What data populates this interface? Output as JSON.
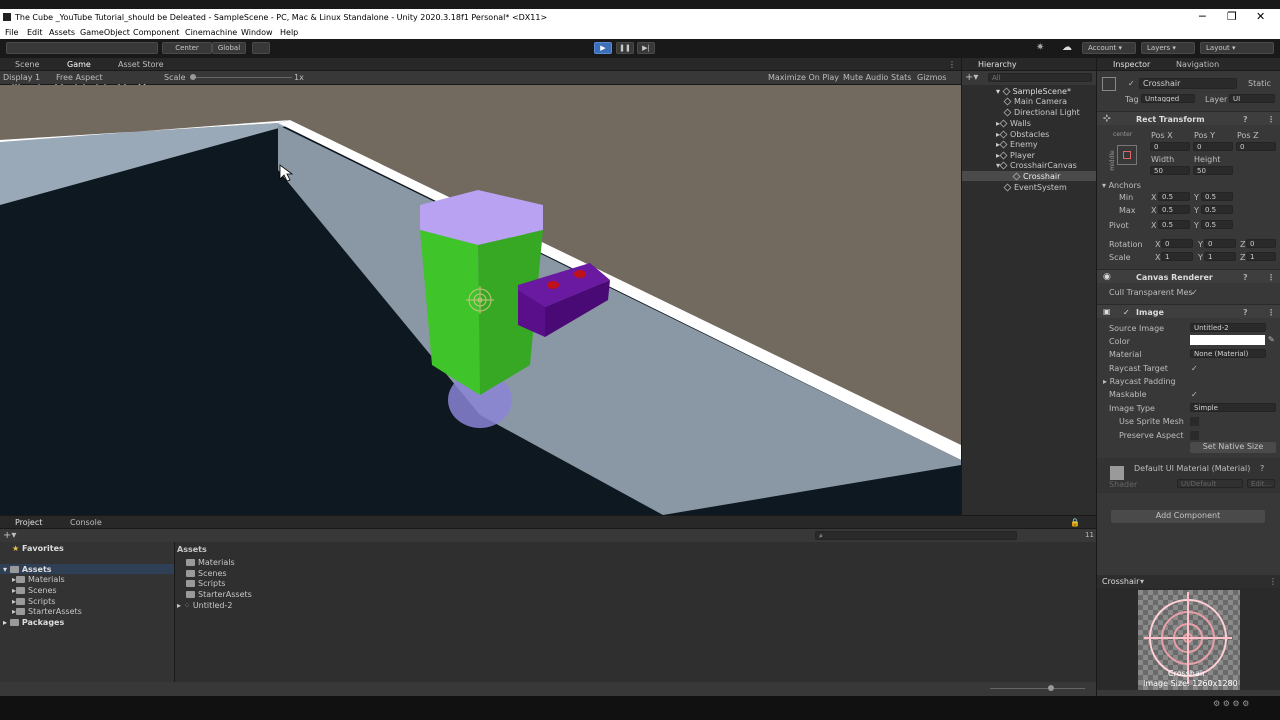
{
  "window": {
    "title": "The Cube _YouTube Tutorial_should be Deleated - SampleScene - PC, Mac & Linux Standalone - Unity 2020.3.18f1 Personal* <DX11>",
    "controls": [
      "─",
      "❐",
      "✕"
    ]
  },
  "menu": [
    "File",
    "Edit",
    "Assets",
    "GameObject",
    "Component",
    "Cinemachine",
    "Window",
    "Help"
  ],
  "toolbar": {
    "pivot": "Center",
    "space": "Global",
    "account": "Account",
    "layers": "Layers",
    "layout": "Layout"
  },
  "view_tabs": {
    "scene": "Scene",
    "game": "Game",
    "asset_store": "Asset Store"
  },
  "game_bar": {
    "display": "Display 1",
    "aspect": "Free Aspect",
    "scale_label": "Scale",
    "scale_value": "1x",
    "maximize": "Maximize On Play",
    "mute": "Mute Audio",
    "stats": "Stats",
    "gizmos": "Gizmos"
  },
  "hierarchy": {
    "tab": "Hierarchy",
    "search_placeholder": "All",
    "scene": "SampleScene*",
    "items": [
      "Main Camera",
      "Directional Light",
      "Walls",
      "Obstacles",
      "Enemy",
      "Player",
      "CrosshairCanvas",
      "Crosshair",
      "EventSystem"
    ]
  },
  "inspector": {
    "tabs": [
      "Inspector",
      "Navigation"
    ],
    "object_name": "Crosshair",
    "static_label": "Static",
    "tag_label": "Tag",
    "tag_value": "Untagged",
    "layer_label": "Layer",
    "layer_value": "UI",
    "rect_transform": {
      "title": "Rect Transform",
      "anchor_preset_h": "center",
      "anchor_preset_v": "middle",
      "posx_label": "Pos X",
      "posy_label": "Pos Y",
      "posz_label": "Pos Z",
      "posx": "0",
      "posy": "0",
      "posz": "0",
      "width_label": "Width",
      "height_label": "Height",
      "width": "50",
      "height": "50",
      "anchors_label": "Anchors",
      "min_label": "Min",
      "max_label": "Max",
      "pivot_label": "Pivot",
      "x_label": "X",
      "y_label": "Y",
      "z_label": "Z",
      "min_x": "0.5",
      "min_y": "0.5",
      "max_x": "0.5",
      "max_y": "0.5",
      "pivot_x": "0.5",
      "pivot_y": "0.5",
      "rotation_label": "Rotation",
      "rot_x": "0",
      "rot_y": "0",
      "rot_z": "0",
      "scale_label": "Scale",
      "scale_x": "1",
      "scale_y": "1",
      "scale_z": "1"
    },
    "canvas_renderer": {
      "title": "Canvas Renderer",
      "cull_label": "Cull Transparent Mes",
      "cull_checked": "✓"
    },
    "image": {
      "title": "Image",
      "source_label": "Source Image",
      "source_value": "Untitled-2",
      "color_label": "Color",
      "color_value": "#ffffff",
      "material_label": "Material",
      "material_value": "None (Material)",
      "raycast_label": "Raycast Target",
      "raycast_padding_label": "Raycast Padding",
      "maskable_label": "Maskable",
      "type_label": "Image Type",
      "type_value": "Simple",
      "sprite_mesh_label": "Use Sprite Mesh",
      "preserve_label": "Preserve Aspect",
      "native_size_button": "Set Native Size",
      "check": "✓"
    },
    "material": {
      "title": "Default UI Material (Material)",
      "shader_label": "Shader",
      "shader_value": "UI/Default",
      "edit_button": "Edit..."
    },
    "add_component": "Add Component",
    "preview": {
      "title": "Crosshair",
      "caption_name": "Crosshair",
      "caption_size": "Image Size: 1260x1280"
    }
  },
  "project": {
    "tabs": [
      "Project",
      "Console"
    ],
    "favorites": "Favorites",
    "assets_root": "Assets",
    "tree": [
      "Materials",
      "Scenes",
      "Scripts",
      "StarterAssets"
    ],
    "packages": "Packages",
    "breadcrumb": "Assets",
    "files": [
      "Materials",
      "Scenes",
      "Scripts",
      "StarterAssets",
      "Untitled-2"
    ],
    "hidden_count": "11"
  },
  "colors": {
    "editor_bg": "#383838",
    "wall_white": "#ffffff",
    "floor_dark": "#0e1820",
    "player_green": "#3fc429",
    "player_top": "#b9a2f2",
    "gun_purple": "#5a0f8a",
    "ball_blue": "#8a84d6",
    "sky_brown": "#72695f",
    "play_blue": "#3d6fb8"
  }
}
